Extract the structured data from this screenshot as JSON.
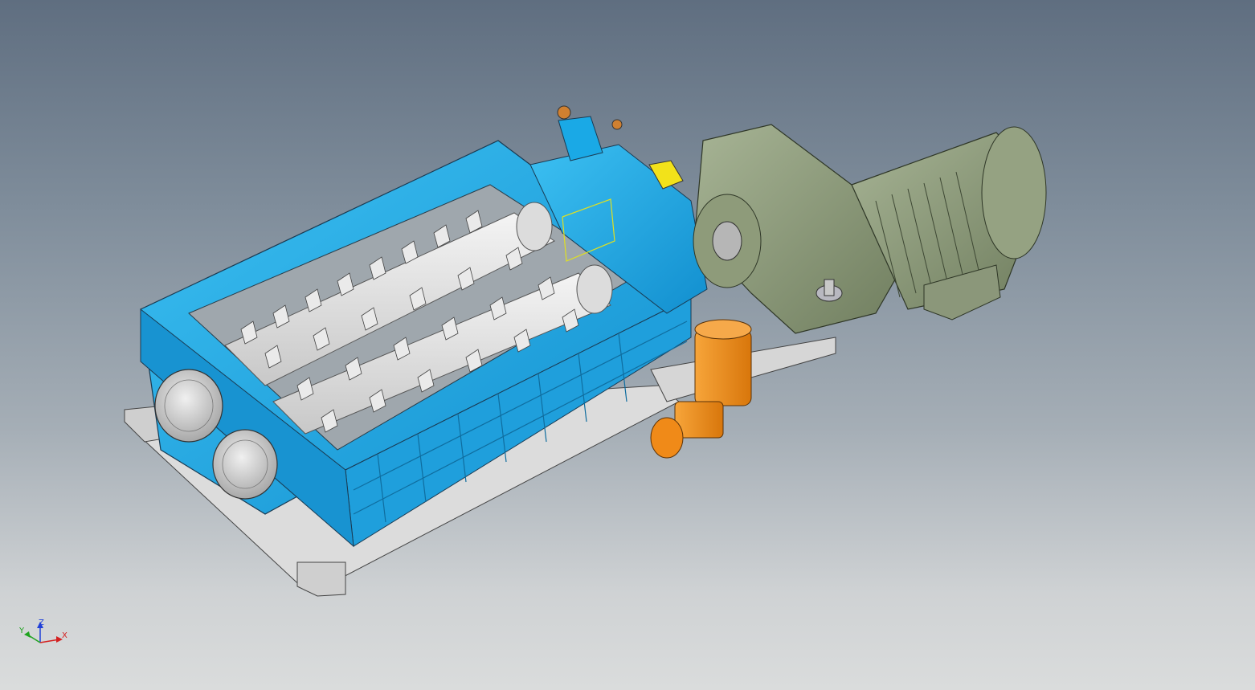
{
  "viewport": {
    "background_top": "#5f6e80",
    "background_bottom": "#dadcdc"
  },
  "model": {
    "parts": [
      {
        "name": "shredder-housing",
        "color": "#1aa9e6"
      },
      {
        "name": "cutting-rotor-upper",
        "color": "#e2e2e2"
      },
      {
        "name": "cutting-rotor-lower",
        "color": "#e2e2e2"
      },
      {
        "name": "bearing-cover-left",
        "color": "#d6d6d6"
      },
      {
        "name": "bearing-cover-right",
        "color": "#d6d6d6"
      },
      {
        "name": "gear-housing",
        "color": "#1aa9e6"
      },
      {
        "name": "gearbox",
        "color": "#8c9a78"
      },
      {
        "name": "electric-motor",
        "color": "#8c9a78"
      },
      {
        "name": "hydraulic-unit",
        "color": "#f0921a"
      },
      {
        "name": "base-frame",
        "color": "#d8d8d8"
      },
      {
        "name": "yellow-coupling",
        "color": "#f2e21a"
      }
    ]
  },
  "triad": {
    "labels": {
      "x": "X",
      "y": "Y",
      "z": "Z"
    },
    "colors": {
      "x": "#d42020",
      "y": "#1fa31f",
      "z": "#2040d8"
    }
  }
}
